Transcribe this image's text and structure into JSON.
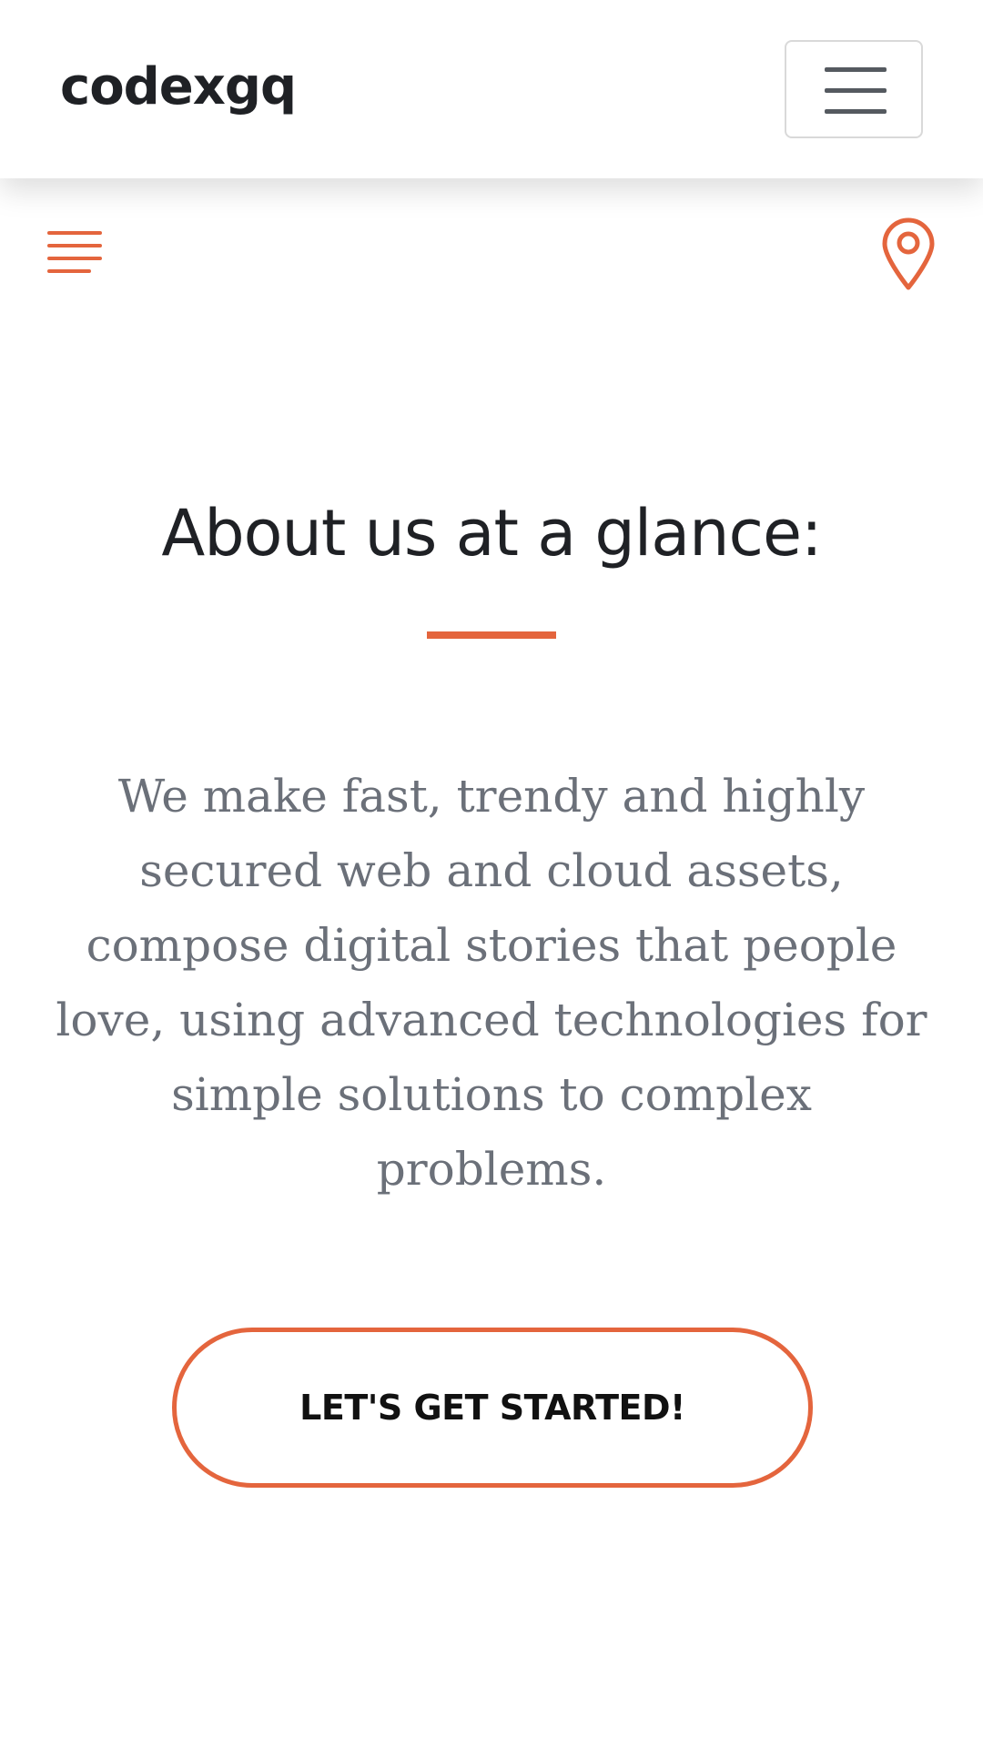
{
  "navbar": {
    "brand": "codexgq",
    "toggler_icon": "hamburger-icon"
  },
  "subbar": {
    "menu_icon": "menu-lines-icon",
    "location_icon": "map-pin-icon"
  },
  "about": {
    "heading": "About us at a glance:",
    "paragraph": "We make fast, trendy and highly secured web and cloud assets, compose digital stories that people love, using advanced technologies for simple solutions to complex problems.",
    "cta_label": "LET'S GET STARTED!"
  },
  "colors": {
    "accent": "#e4653d",
    "heading_text": "#1f2125",
    "body_text": "#6b7079",
    "toggler_bar": "#555a60"
  }
}
